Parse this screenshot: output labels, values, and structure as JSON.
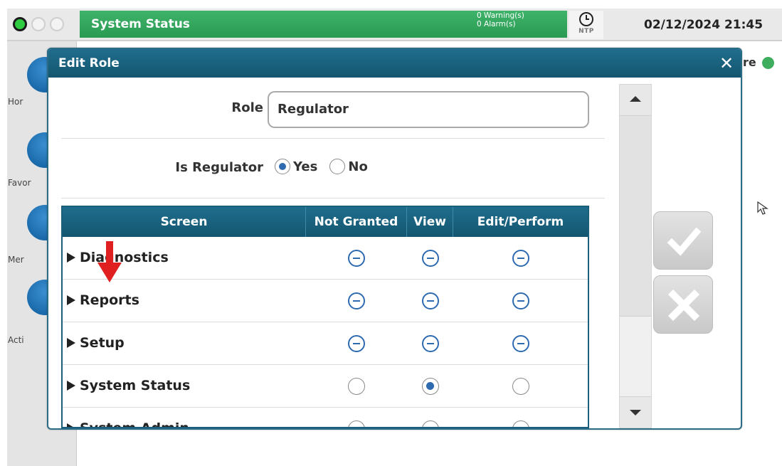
{
  "topbar": {
    "title": "System Status",
    "warnings": "0 Warning(s)",
    "alarms": "0 Alarm(s)",
    "ntp_label": "NTP",
    "datetime": "02/12/2024 21:45"
  },
  "leftnav": {
    "home": "Hor",
    "favorites": "Favor",
    "menu": "Mer",
    "actions": "Acti"
  },
  "background_fragment": "re",
  "dialog": {
    "title": "Edit Role",
    "close_glyph": "✕",
    "role_label": "Role",
    "role_value": "Regulator",
    "is_regulator_label": "Is Regulator",
    "yes_label": "Yes",
    "no_label": "No",
    "is_regulator_selected": "Yes"
  },
  "table": {
    "headers": [
      "Screen",
      "Not Granted",
      "View",
      "Edit/Perform"
    ],
    "rows": [
      {
        "screen": "Diagnostics",
        "state": "mixed"
      },
      {
        "screen": "Reports",
        "state": "mixed"
      },
      {
        "screen": "Setup",
        "state": "mixed"
      },
      {
        "screen": "System Status",
        "state": "view"
      },
      {
        "screen": "System Admin",
        "state": "partial"
      }
    ]
  },
  "colors": {
    "header_teal": "#1a6483",
    "status_green": "#35a85e",
    "radio_blue": "#2e6ab0",
    "annotation_red": "#e02020"
  },
  "icons": {
    "confirm": "check-icon",
    "cancel": "close-icon",
    "annotation": "red-arrow-icon"
  }
}
